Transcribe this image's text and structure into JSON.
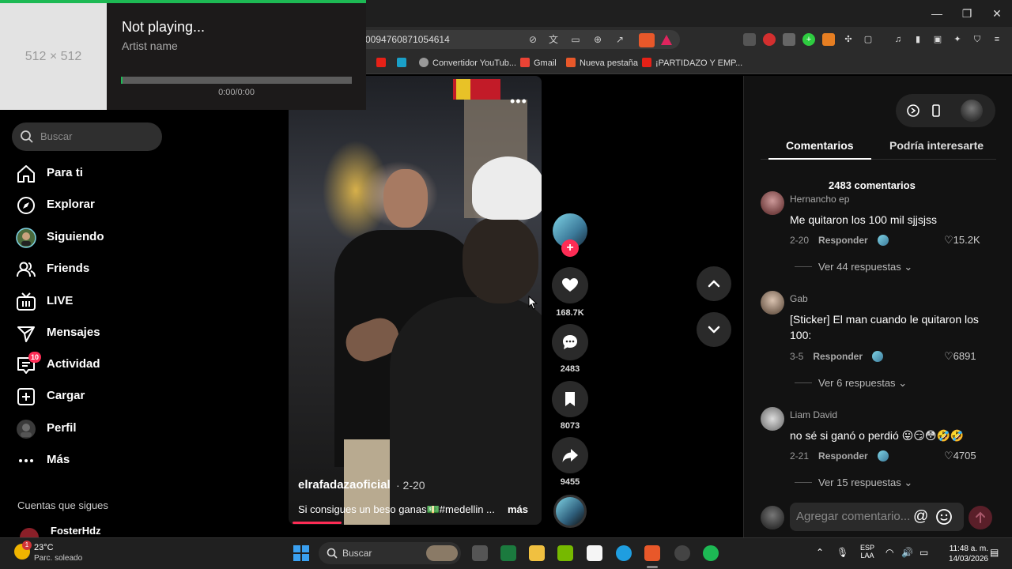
{
  "window": {
    "minimize": "—",
    "maximize": "❐",
    "close": "✕"
  },
  "address": {
    "url_visible": "0094760871054614"
  },
  "bookmarks": [
    {
      "label": ""
    },
    {
      "label": ""
    },
    {
      "label": "Convertidor YouTub..."
    },
    {
      "label": "Gmail"
    },
    {
      "label": "Nueva pestaña"
    },
    {
      "label": "¡PARTIDAZO Y EMP..."
    }
  ],
  "media": {
    "album_placeholder": "512 × 512",
    "title": "Not playing...",
    "artist": "Artist name",
    "time": "0:00/0:00"
  },
  "sidebar": {
    "search_placeholder": "Buscar",
    "nav": [
      {
        "label": "Para ti",
        "icon": "home-icon"
      },
      {
        "label": "Explorar",
        "icon": "compass-icon"
      },
      {
        "label": "Siguiendo",
        "icon": "following-avatar-icon"
      },
      {
        "label": "Friends",
        "icon": "friends-icon"
      },
      {
        "label": "LIVE",
        "icon": "live-icon"
      },
      {
        "label": "Mensajes",
        "icon": "send-icon"
      },
      {
        "label": "Actividad",
        "icon": "inbox-icon",
        "badge": "10"
      },
      {
        "label": "Cargar",
        "icon": "upload-icon"
      },
      {
        "label": "Perfil",
        "icon": "profile-avatar-icon"
      },
      {
        "label": "Más",
        "icon": "more-icon"
      }
    ],
    "following_title": "Cuentas que sigues",
    "following_users": [
      "FosterHdz"
    ]
  },
  "video": {
    "author": "elrafadazaoficial",
    "date": "· 2-20",
    "caption": "Si consigues un beso ganas💵#medellin ...",
    "more": "más",
    "progress": 0.2
  },
  "actions": {
    "likes": "168.7K",
    "comments": "2483",
    "saves": "8073",
    "shares": "9455"
  },
  "panel": {
    "tabs": [
      "Comentarios",
      "Podría interesarte"
    ],
    "active_tab": 0,
    "comments_count": "2483 comentarios",
    "reply_label": "Responder",
    "comments": [
      {
        "user": "Hernancho ep",
        "text": "Me quitaron los 100 mil sjjsjss",
        "date": "2-20",
        "likes": "15.2K",
        "replies": "Ver 44 respuestas"
      },
      {
        "user": "Gab",
        "text": "[Sticker] El man cuando le quitaron los 100:",
        "date": "3-5",
        "likes": "6891",
        "replies": "Ver 6 respuestas"
      },
      {
        "user": "Liam David",
        "text": "no sé si ganó o perdió 😛😏😳🤣🤣",
        "date": "2-21",
        "likes": "4705",
        "replies": "Ver 15 respuestas"
      }
    ],
    "composer_placeholder": "Agregar comentario...",
    "composer_at": "@"
  },
  "taskbar": {
    "weather_badge": "1",
    "temperature": "23°C",
    "condition": "Parc. soleado",
    "search": "Buscar",
    "lang_top": "ESP",
    "lang_bottom": "LAA",
    "time": "11:48 a. m.",
    "date": "14/03/2026"
  },
  "colors": {
    "accent": "#fe2c55",
    "media_green": "#1db954",
    "background": "#000000"
  }
}
